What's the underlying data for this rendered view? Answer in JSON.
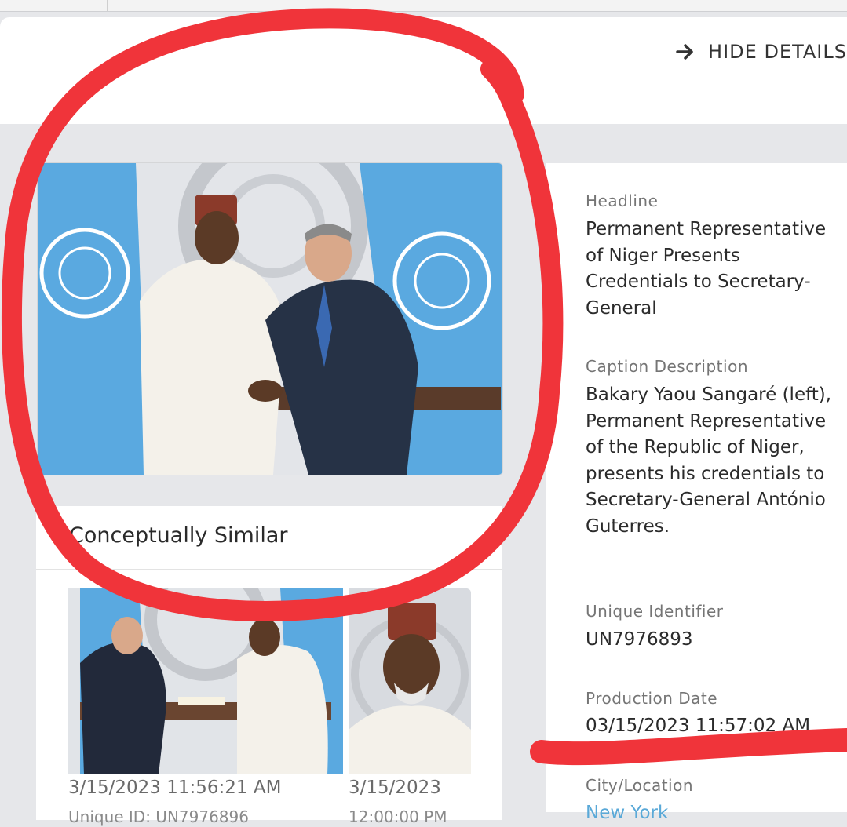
{
  "header": {
    "hide_details_label": "HIDE DETAILS"
  },
  "similar": {
    "title": "Conceptually Similar",
    "items": [
      {
        "date": "3/15/2023 11:56:21 AM",
        "sub": "Unique ID: UN7976896"
      },
      {
        "date": "3/15/2023",
        "sub": "12:00:00 PM"
      }
    ]
  },
  "details": {
    "headline_label": "Headline",
    "headline_value": "Permanent Representative of Niger Presents Credentials to Secretary-General",
    "caption_label": "Caption Description",
    "caption_value": "Bakary Yaou Sangaré (left), Permanent Representative of the Republic of Niger, presents his credentials to Secretary-General António Guterres.",
    "uid_label": "Unique Identifier",
    "uid_value": "UN7976893",
    "production_label": "Production Date",
    "production_value": "03/15/2023 11:57:02 AM",
    "city_label": "City/Location",
    "city_value": "New York"
  },
  "colors": {
    "annotation_red": "#f0343a",
    "un_blue": "#5aa9e0",
    "link_blue": "#5aa9d8"
  },
  "icons": {
    "hide_details": "arrow-right-icon"
  }
}
